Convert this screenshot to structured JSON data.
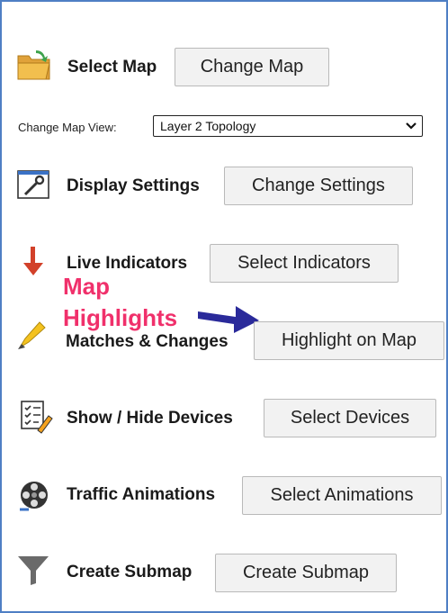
{
  "panel": {
    "select_map": {
      "label": "Select Map",
      "button": "Change Map",
      "icon": "folder-icon"
    },
    "map_view": {
      "label": "Change Map View:",
      "selected": "Layer 2 Topology"
    },
    "display_settings": {
      "label": "Display Settings",
      "button": "Change Settings",
      "icon": "settings-wrench-icon"
    },
    "live_indicators": {
      "label": "Live Indicators",
      "button": "Select Indicators",
      "icon": "red-down-arrow-icon"
    },
    "matches_changes": {
      "label": "Matches & Changes",
      "button": "Highlight on Map",
      "icon": "highlighter-icon"
    },
    "show_hide_devices": {
      "label": "Show / Hide Devices",
      "button": "Select Devices",
      "icon": "checklist-icon"
    },
    "traffic_animations": {
      "label": "Traffic Animations",
      "button": "Select Animations",
      "icon": "film-reel-icon"
    },
    "create_submap": {
      "label": "Create Submap",
      "button": "Create Submap",
      "icon": "funnel-icon"
    }
  },
  "annotation": {
    "line1": "Map",
    "line2": "Highlights",
    "color": "#f0306b",
    "arrow_color": "#2a2a9a"
  },
  "colors": {
    "frame_border": "#4f7fc4",
    "button_bg": "#f2f2f2"
  }
}
